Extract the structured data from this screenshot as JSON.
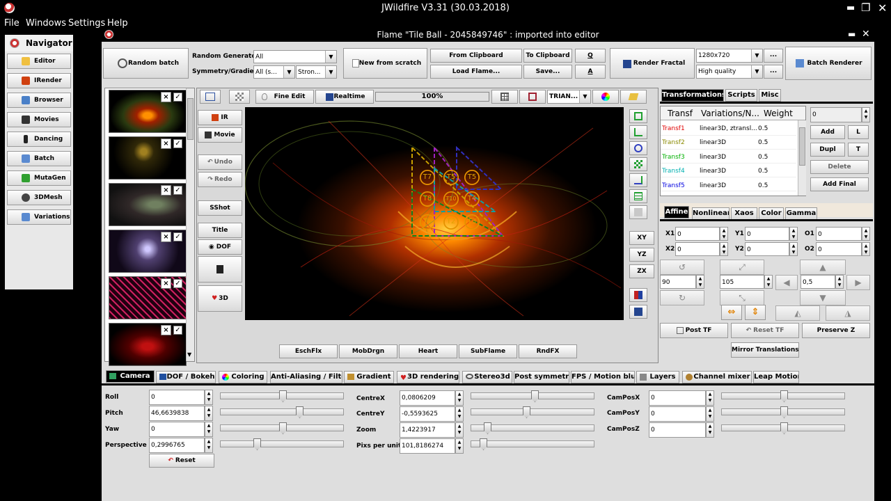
{
  "window": {
    "title": "JWildfire V3.31 (30.03.2018)"
  },
  "menu": [
    "File",
    "Windows",
    "Settings",
    "Help"
  ],
  "navigator": {
    "title": "Navigator",
    "items": [
      "Editor",
      "IRender",
      "Browser",
      "Movies",
      "Dancing",
      "Batch",
      "MutaGen",
      "3DMesh",
      "Variations"
    ]
  },
  "editor": {
    "title": "Flame \"Tile Ball - 2045849746\" : imported into editor"
  },
  "toolbar": {
    "random_batch": "Random batch",
    "random_generator_label": "Random Generator",
    "random_generator_value": "All",
    "symmetry_label": "Symmetry/Gradient",
    "symmetry_value": "All (s...",
    "gradient_value": "Stron...",
    "new_from_scratch": "New from scratch",
    "from_clipboard": "From Clipboard",
    "to_clipboard": "To Clipboard",
    "q": "Q",
    "load_flame": "Load Flame...",
    "save": "Save...",
    "a": "A",
    "render_fractal": "Render Fractal",
    "resolution": "1280x720",
    "quality": "High quality",
    "ellipsis": "...",
    "batch_renderer": "Batch Renderer"
  },
  "preview_toolbar": {
    "fine_edit": "Fine Edit",
    "realtime": "Realtime",
    "progress": "100%",
    "mode": "TRIAN..."
  },
  "left_buttons": {
    "ir": "IR",
    "movie": "Movie",
    "undo": "Undo",
    "redo": "Redo",
    "sshot": "SShot",
    "title": "Title",
    "dof": "DOF",
    "three_d": "3D"
  },
  "right_buttons": {
    "xy": "XY",
    "yz": "YZ",
    "zx": "ZX"
  },
  "transform_labels": [
    "T1",
    "T2",
    "T3",
    "T4",
    "T5",
    "T6",
    "T7",
    "T8",
    "T9",
    "T10"
  ],
  "bottom_buttons": [
    "EschFlx",
    "MobDrgn",
    "Heart",
    "SubFlame",
    "RndFX"
  ],
  "right_panel": {
    "tabs": [
      "Transformations",
      "Scripts",
      "Misc"
    ],
    "columns": [
      "Transf",
      "Variations/N...",
      "Weight"
    ],
    "rows": [
      {
        "name": "Transf1",
        "variations": "linear3D, ztransl...",
        "weight": "0.5",
        "color": "#e00000"
      },
      {
        "name": "Transf2",
        "variations": "linear3D",
        "weight": "0.5",
        "color": "#8a8a00"
      },
      {
        "name": "Transf3",
        "variations": "linear3D",
        "weight": "0.5",
        "color": "#00b000"
      },
      {
        "name": "Transf4",
        "variations": "linear3D",
        "weight": "0.5",
        "color": "#00b0b0"
      },
      {
        "name": "Transf5",
        "variations": "linear3D",
        "weight": "0.5",
        "color": "#0000e0"
      }
    ],
    "count_value": "0",
    "add": "Add",
    "l": "L",
    "dupl": "Dupl",
    "t": "T",
    "delete": "Delete",
    "add_final": "Add Final",
    "subtabs": [
      "Affine",
      "Nonlinear",
      "Xaos",
      "Color",
      "Gamma"
    ],
    "affine": {
      "x1_label": "X1",
      "x1": "0",
      "y1_label": "Y1",
      "y1": "0",
      "o1_label": "O1",
      "o1": "0",
      "x2_label": "X2",
      "x2": "0",
      "y2_label": "Y2",
      "y2": "0",
      "o2_label": "O2",
      "o2": "0",
      "rotate_value": "90",
      "scale_value": "105",
      "move_value": "0,5"
    },
    "post_tf": "Post TF",
    "reset_tf": "Reset TF",
    "preserve_z": "Preserve Z",
    "mirror_translations": "Mirror Translations"
  },
  "bottom_tabs": [
    "Camera",
    "DOF / Bokeh",
    "Coloring",
    "Anti-Aliasing / Filter",
    "Gradient",
    "3D rendering",
    "Stereo3d",
    "Post symmetry",
    "FPS / Motion blur",
    "Layers",
    "Channel mixer",
    "Leap Motion"
  ],
  "camera": {
    "roll_label": "Roll",
    "roll": "0",
    "pitch_label": "Pitch",
    "pitch": "46,6639838",
    "yaw_label": "Yaw",
    "yaw": "0",
    "perspective_label": "Perspective",
    "perspective": "0,2996765",
    "reset": "Reset",
    "centrex_label": "CentreX",
    "centrex": "0,0806209",
    "centrey_label": "CentreY",
    "centrey": "-0,5593625",
    "zoom_label": "Zoom",
    "zoom": "1,4223917",
    "pixs_label": "Pixs per unit",
    "pixs": "101,8186274",
    "camposx_label": "CamPosX",
    "camposx": "0",
    "camposy_label": "CamPosY",
    "camposy": "0",
    "camposz_label": "CamPosZ",
    "camposz": "0"
  },
  "colors": {
    "accent_transf1": "#e00000",
    "selected_tab": "#000000"
  }
}
